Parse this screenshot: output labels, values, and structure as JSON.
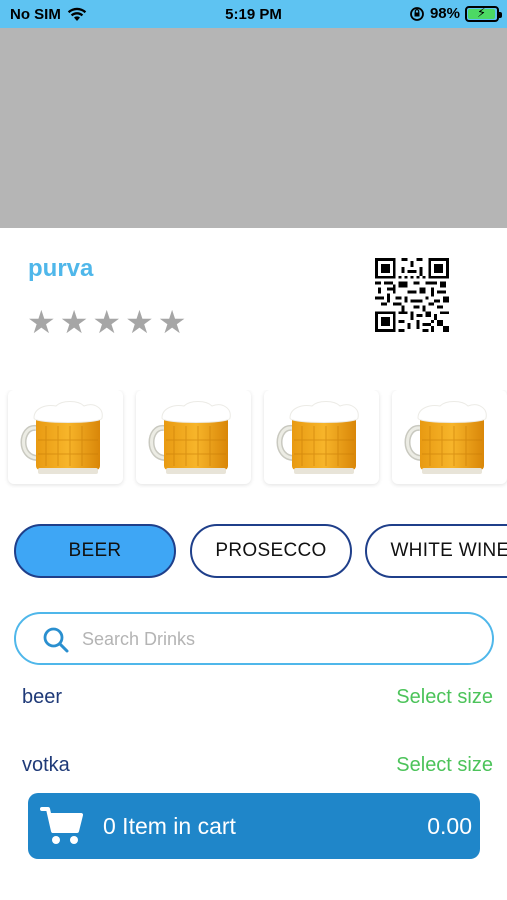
{
  "status_bar": {
    "carrier": "No SIM",
    "time": "5:19 PM",
    "battery": "98%",
    "battery_level": 0.98,
    "icons": [
      "wifi-icon",
      "orientation-lock-icon",
      "battery-charging-icon"
    ]
  },
  "store": {
    "name": "purva",
    "rating": 0,
    "rating_max": 5
  },
  "products": [
    {
      "icon": "beer-mug-image"
    },
    {
      "icon": "beer-mug-image"
    },
    {
      "icon": "beer-mug-image"
    },
    {
      "icon": "beer-mug-image"
    }
  ],
  "categories": [
    {
      "label": "BEER",
      "active": true
    },
    {
      "label": "PROSECCO",
      "active": false
    },
    {
      "label": "WHITE WINE",
      "active": false
    }
  ],
  "search": {
    "placeholder": "Search Drinks",
    "value": ""
  },
  "drinks": [
    {
      "name": "beer",
      "action": "Select size"
    },
    {
      "name": "votka",
      "action": "Select size"
    }
  ],
  "cart": {
    "label": "0 Item in cart",
    "total": "0.00"
  },
  "colors": {
    "status_bar": "#5ec3f2",
    "accent": "#4fb7ea",
    "active_category": "#3ea6f5",
    "select_size": "#4cc35a",
    "cart_bar": "#1f86c9"
  }
}
